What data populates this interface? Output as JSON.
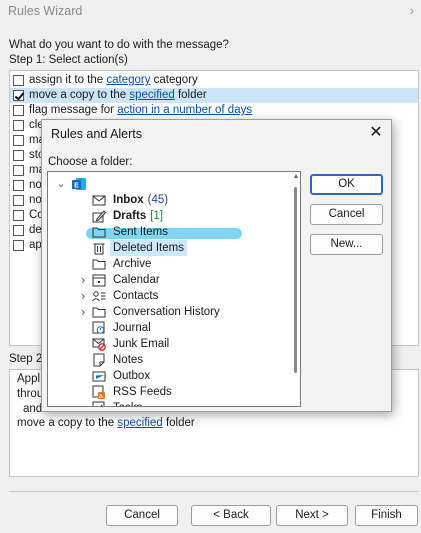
{
  "wizard": {
    "title": "Rules Wizard",
    "question": "What do you want to do with the message?",
    "step1_label": "Step 1: Select action(s)",
    "actions": [
      {
        "pre": "assign it to the ",
        "link": "category",
        "post": " category",
        "checked": false,
        "selected": false
      },
      {
        "pre": "move a copy to the ",
        "link": "specified",
        "post": " folder",
        "checked": true,
        "selected": true
      },
      {
        "pre": "flag message for ",
        "link": "action in a number of days",
        "post": "",
        "checked": false,
        "selected": false
      },
      {
        "pre": "cle",
        "link": "",
        "post": "",
        "checked": false,
        "selected": false
      },
      {
        "pre": "ma",
        "link": "",
        "post": "",
        "checked": false,
        "selected": false
      },
      {
        "pre": "sto",
        "link": "",
        "post": "",
        "checked": false,
        "selected": false
      },
      {
        "pre": "ma",
        "link": "",
        "post": "",
        "checked": false,
        "selected": false
      },
      {
        "pre": "no",
        "link": "",
        "post": "",
        "checked": false,
        "selected": false
      },
      {
        "pre": "no",
        "link": "",
        "post": "",
        "checked": false,
        "selected": false
      },
      {
        "pre": "Co",
        "link": "",
        "post": "",
        "checked": false,
        "selected": false
      },
      {
        "pre": "de",
        "link": "",
        "post": "",
        "checked": false,
        "selected": false
      },
      {
        "pre": "ap",
        "link": "",
        "post": "",
        "checked": false,
        "selected": false
      }
    ],
    "step2_label": "Step 2",
    "description": {
      "line1": "Appl",
      "line2": "throu",
      "line3": "and",
      "line4_pre": "move a copy to the ",
      "line4_link": "specified",
      "line4_post": " folder"
    },
    "buttons": {
      "cancel": "Cancel",
      "back": "< Back",
      "next": "Next >",
      "finish": "Finish"
    }
  },
  "dialog": {
    "title": "Rules and Alerts",
    "choose_label": "Choose a folder:",
    "buttons": {
      "ok": "OK",
      "cancel": "Cancel",
      "new": "New..."
    },
    "folders": [
      {
        "name": "Inbox",
        "count": "(45)",
        "count_color": "#1f3fa8",
        "bold": true,
        "icon": "inbox-icon",
        "expander": ""
      },
      {
        "name": "Drafts",
        "count": "[1]",
        "count_color": "#1f8a3a",
        "bold": true,
        "icon": "drafts-icon",
        "expander": ""
      },
      {
        "name": "Sent Items",
        "count": "",
        "bold": false,
        "icon": "folder-icon",
        "expander": ""
      },
      {
        "name": "Deleted Items",
        "count": "",
        "bold": false,
        "icon": "trash-icon",
        "expander": "",
        "highlighted": true
      },
      {
        "name": "Archive",
        "count": "",
        "bold": false,
        "icon": "folder-icon",
        "expander": ""
      },
      {
        "name": "Calendar",
        "count": "",
        "bold": false,
        "icon": "calendar-icon",
        "expander": "›"
      },
      {
        "name": "Contacts",
        "count": "",
        "bold": false,
        "icon": "contacts-icon",
        "expander": "›"
      },
      {
        "name": "Conversation History",
        "count": "",
        "bold": false,
        "icon": "folder-icon",
        "expander": "›"
      },
      {
        "name": "Journal",
        "count": "",
        "bold": false,
        "icon": "journal-icon",
        "expander": ""
      },
      {
        "name": "Junk Email",
        "count": "",
        "bold": false,
        "icon": "junk-icon",
        "expander": ""
      },
      {
        "name": "Notes",
        "count": "",
        "bold": false,
        "icon": "notes-icon",
        "expander": ""
      },
      {
        "name": "Outbox",
        "count": "",
        "bold": false,
        "icon": "outbox-icon",
        "expander": ""
      },
      {
        "name": "RSS Feeds",
        "count": "",
        "bold": false,
        "icon": "rss-icon",
        "expander": ""
      },
      {
        "name": "Tasks",
        "count": "",
        "bold": false,
        "icon": "tasks-icon",
        "expander": ""
      }
    ],
    "colors": {
      "selection": "#cce4f7",
      "highlight": "#cce8ff",
      "link": "#0b4ea8",
      "outlook_blue": "#0f6cbd",
      "redaction": "#6fd0ee"
    }
  }
}
